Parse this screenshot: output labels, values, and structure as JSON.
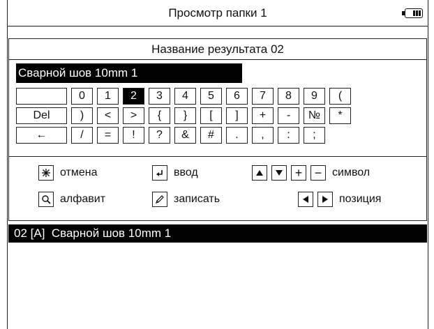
{
  "title": "Просмотр папки 1",
  "panel_title": "Название результата 02",
  "name_value": "Сварной шов 10mm 1",
  "keyboard": {
    "row1": [
      "",
      "0",
      "1",
      "2",
      "3",
      "4",
      "5",
      "6",
      "7",
      "8",
      "9",
      "("
    ],
    "row2": [
      "Del",
      ")",
      "<",
      ">",
      "{",
      "}",
      "[",
      "]",
      "+",
      "-",
      "№",
      "*"
    ],
    "row3": [
      "←",
      "/",
      "=",
      "!",
      "?",
      "&",
      "#",
      ".",
      ",",
      ":",
      ";"
    ],
    "selected_key": "2"
  },
  "legend": {
    "cancel": "отмена",
    "enter": "ввод",
    "symbol": "символ",
    "alphabet": "алфавит",
    "write": "записать",
    "position": "позиция"
  },
  "icons": {
    "cancel": "snowflake-icon",
    "enter": "enter-arrow-icon",
    "alphabet": "magnifier-icon",
    "write": "pencil-icon",
    "up": "triangle-up-icon",
    "down": "triangle-down-icon",
    "plus": "plus-icon",
    "minus": "minus-icon",
    "left": "triangle-left-icon",
    "right": "triangle-right-icon",
    "battery": "battery-icon"
  },
  "result_row": "02 [A]  Сварной шов 10mm 1"
}
